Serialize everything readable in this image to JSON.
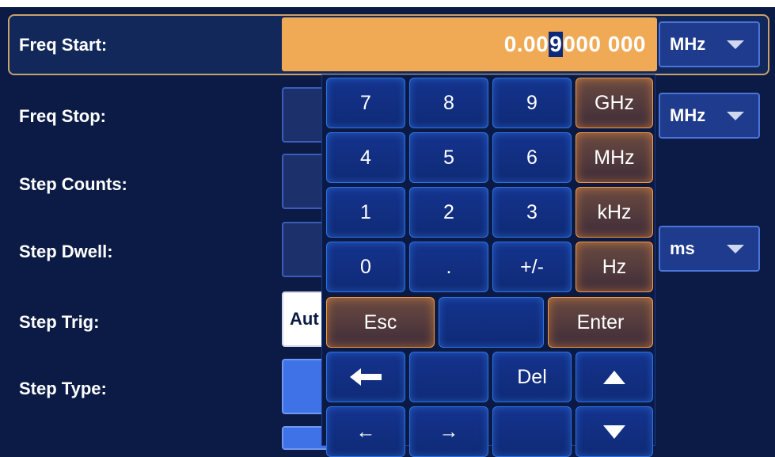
{
  "rows": {
    "freq_start": {
      "label": "Freq Start:",
      "value_prefix": "0.00",
      "value_cursor": "9",
      "value_suffix": " 000 000",
      "unit": "MHz"
    },
    "freq_stop": {
      "label": "Freq Stop:",
      "unit": "MHz"
    },
    "step_counts": {
      "label": "Step Counts:"
    },
    "step_dwell": {
      "label": "Step Dwell:",
      "unit": "ms"
    },
    "step_trig": {
      "label": "Step Trig:",
      "value": "Aut"
    },
    "step_type": {
      "label": "Step Type:"
    }
  },
  "keypad": {
    "k7": "7",
    "k8": "8",
    "k9": "9",
    "ghz": "GHz",
    "k4": "4",
    "k5": "5",
    "k6": "6",
    "mhz": "MHz",
    "k1": "1",
    "k2": "2",
    "k3": "3",
    "khz": "kHz",
    "k0": "0",
    "dot": ".",
    "sign": "+/-",
    "hz": "Hz",
    "esc": "Esc",
    "enter": "Enter",
    "backspace": "🡐",
    "del": "Del",
    "left": "←",
    "right": "→"
  },
  "colors": {
    "background": "#0b1b45",
    "active_field": "#f0a955",
    "key_border_blue": "#2d73e5",
    "key_border_orange": "#f39a42"
  },
  "icons": {
    "dropdown": "chevron-down-icon",
    "up": "arrow-up-icon",
    "down": "arrow-down-icon"
  }
}
